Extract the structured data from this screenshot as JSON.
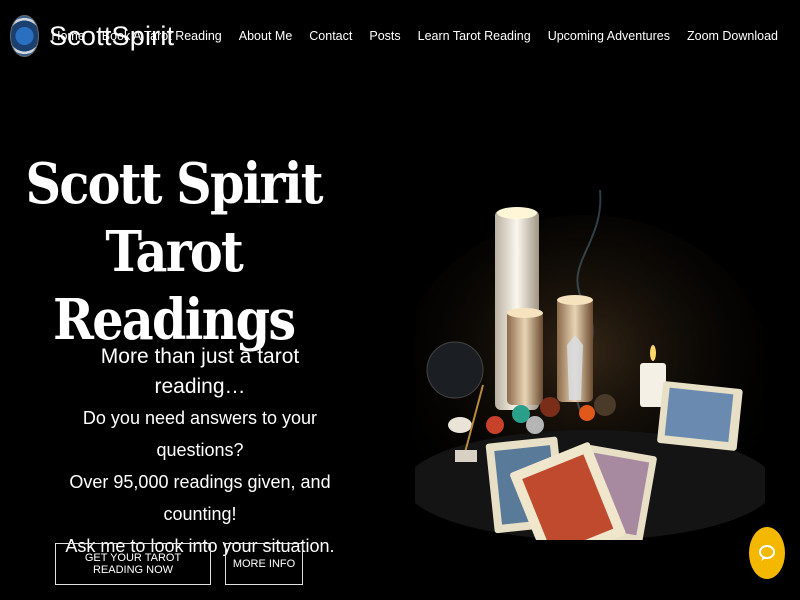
{
  "header": {
    "logo_text": "ScottSpirit",
    "nav": [
      "Home",
      "Book A Tarot Reading",
      "About Me",
      "Contact",
      "Posts",
      "Learn Tarot Reading",
      "Upcoming Adventures",
      "Zoom Download"
    ]
  },
  "hero": {
    "title_line1": "Scott Spirit Tarot",
    "title_line2": "Readings",
    "line1": "More than just a tarot reading…",
    "line2": "Do you need answers to your questions?",
    "line3": "Over 95,000 readings given, and counting!",
    "line4": "Ask me to look into your situation."
  },
  "buttons": {
    "primary": "GET YOUR TAROT READING NOW",
    "secondary": "MORE INFO"
  },
  "colors": {
    "background": "#000000",
    "chat": "#f5b800"
  },
  "icons": {
    "chat": "chat-bubble-icon",
    "logo": "logo-badge-icon"
  }
}
